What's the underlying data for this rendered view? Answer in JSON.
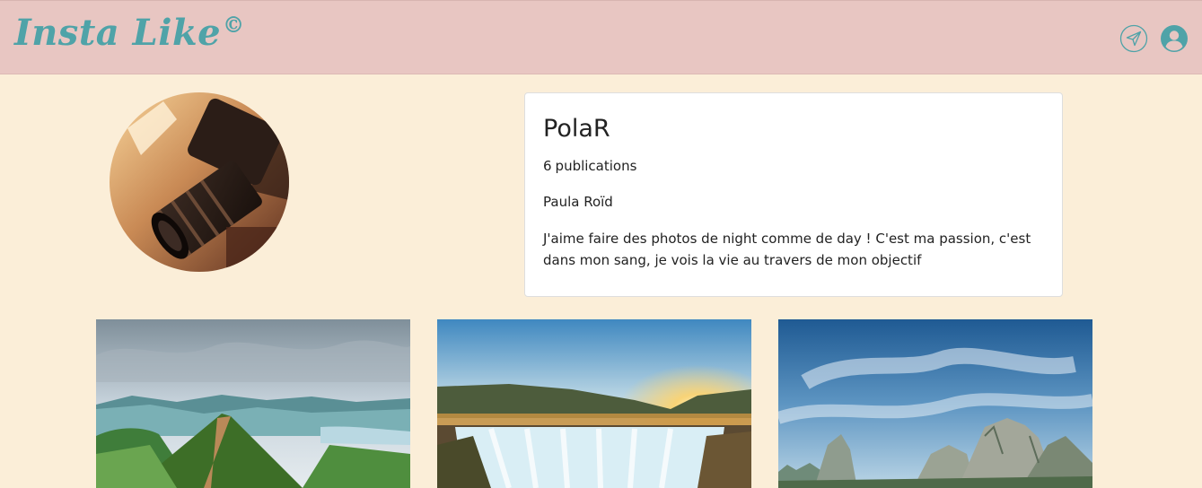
{
  "header": {
    "brand": "Insta Like",
    "brand_mark": "©",
    "icons": [
      "send-icon",
      "user-icon"
    ],
    "brand_color": "#4fa3a8",
    "bar_color": "#e8c6c2"
  },
  "profile": {
    "username": "PolaR",
    "publications_count": "6",
    "publications_label": "publications",
    "full_name": "Paula Roïd",
    "bio": "J'aime faire des photos de night comme de day ! C'est ma passion, c'est dans mon sang, je vois la vie au travers de mon objectif"
  },
  "gallery": [
    {
      "subject": "green-mountain-ridge-photo"
    },
    {
      "subject": "waterfall-sunset-photo"
    },
    {
      "subject": "karst-cliffs-photo"
    }
  ],
  "colors": {
    "page_background": "#fbeed8",
    "card_background": "#ffffff"
  }
}
